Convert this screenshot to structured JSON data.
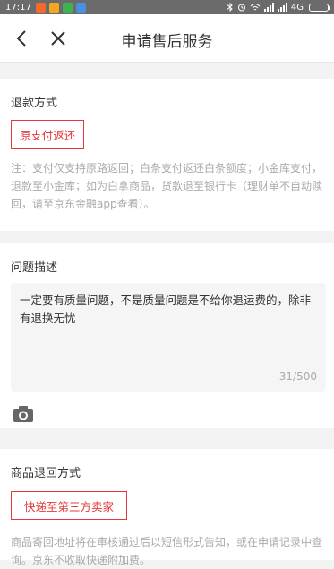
{
  "status_bar": {
    "time": "17:17",
    "network": "4G"
  },
  "nav": {
    "title": "申请售后服务"
  },
  "refund": {
    "label": "退款方式",
    "method_button": "原支付返还",
    "note": "注：支付仅支持原路返回；白条支付返还白条额度；小金库支付，退款至小金库；如为白拿商品，货款退至银行卡（理财单不自动赎回，请至京东金融app查看）。"
  },
  "problem": {
    "label": "问题描述",
    "text": "一定要有质量问题，不是质量问题是不给你退运费的，除非有退换无忧",
    "count": "31/500"
  },
  "return_method": {
    "label": "商品退回方式",
    "method_button": "快递至第三方卖家",
    "note": "商品寄回地址将在审核通过后以短信形式告知，或在申请记录中查询。京东不收取快递附加费。"
  },
  "colors": {
    "accent": "#e4393c",
    "status_bar": "#6b6b6b",
    "background": "#f3f3f3"
  }
}
